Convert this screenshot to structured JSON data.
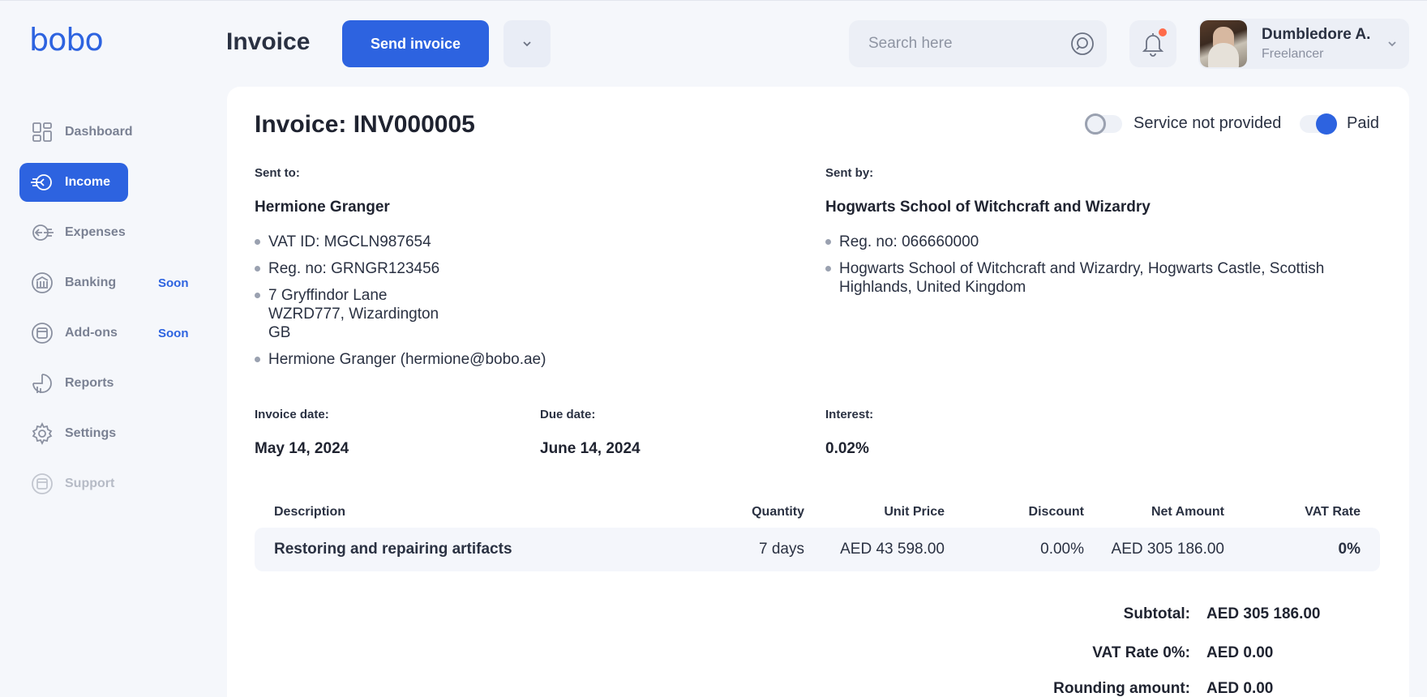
{
  "brand": {
    "logo": "bobo",
    "accent": "#2d63e0"
  },
  "sidebar": {
    "items": [
      {
        "label": "Dashboard",
        "icon": "dashboard-icon",
        "state": "normal",
        "badge": ""
      },
      {
        "label": "Income",
        "icon": "income-icon",
        "state": "active",
        "badge": ""
      },
      {
        "label": "Expenses",
        "icon": "expenses-icon",
        "state": "normal",
        "badge": ""
      },
      {
        "label": "Banking",
        "icon": "bank-icon",
        "state": "normal",
        "badge": "Soon"
      },
      {
        "label": "Add-ons",
        "icon": "addons-icon",
        "state": "normal",
        "badge": "Soon"
      },
      {
        "label": "Reports",
        "icon": "reports-icon",
        "state": "normal",
        "badge": ""
      },
      {
        "label": "Settings",
        "icon": "gear-icon",
        "state": "normal",
        "badge": ""
      },
      {
        "label": "Support",
        "icon": "support-icon",
        "state": "disabled",
        "badge": ""
      }
    ]
  },
  "header": {
    "title": "Invoice",
    "send_label": "Send invoice",
    "search_placeholder": "Search here",
    "user": {
      "name": "Dumbledore A.",
      "role": "Freelancer"
    }
  },
  "invoice": {
    "title": "Invoice: INV000005",
    "toggles": {
      "service_not_provided": "Service not provided",
      "paid": "Paid"
    },
    "sent_to": {
      "label": "Sent to:",
      "name": "Hermione Granger",
      "vat_id": "VAT ID: MGCLN987654",
      "reg_no": "Reg. no: GRNGR123456",
      "address_line1": "7 Gryffindor Lane",
      "address_line2": "WZRD777, Wizardington",
      "address_line3": "GB",
      "contact": "Hermione Granger (hermione@bobo.ae)"
    },
    "sent_by": {
      "label": "Sent by:",
      "name": "Hogwarts School of Witchcraft and Wizardry",
      "reg_no": "Reg. no: 066660000",
      "address_line1": "Hogwarts School of Witchcraft and Wizardry, Hogwarts Castle, Scottish",
      "address_line2": "Highlands, United Kingdom"
    },
    "dates": {
      "invoice_date_label": "Invoice date:",
      "invoice_date": "May 14, 2024",
      "due_date_label": "Due date:",
      "due_date": "June 14, 2024",
      "interest_label": "Interest:",
      "interest": "0.02%"
    },
    "table": {
      "columns": [
        "Description",
        "Quantity",
        "Unit Price",
        "Discount",
        "Net Amount",
        "VAT Rate"
      ],
      "rows": [
        [
          "Restoring and repairing artifacts",
          "7 days",
          "AED 43 598.00",
          "0.00%",
          "AED 305 186.00",
          "0%"
        ]
      ]
    },
    "totals": [
      {
        "label": "Subtotal:",
        "value": "AED 305 186.00"
      },
      {
        "label": "VAT Rate 0%:",
        "value": "AED 0.00"
      },
      {
        "label": "Rounding amount:",
        "value": "AED 0.00"
      }
    ]
  }
}
